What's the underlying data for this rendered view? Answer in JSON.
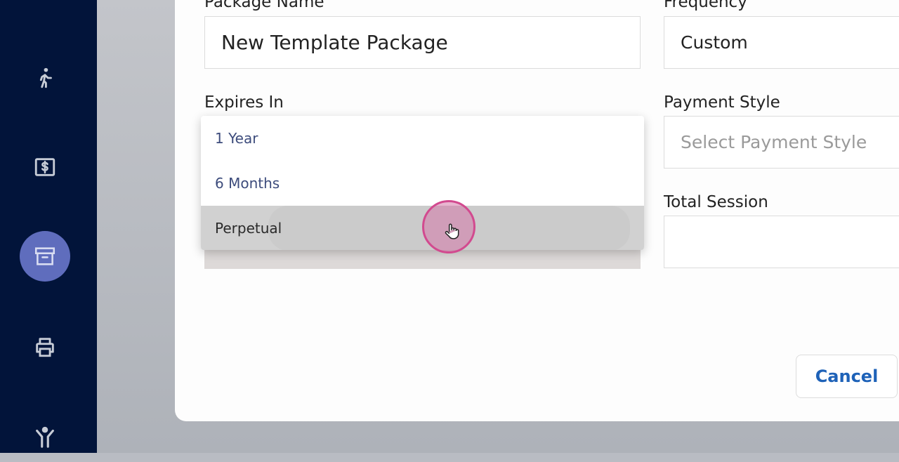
{
  "sidebar": {
    "items": [
      {
        "icon": "walking-person-icon"
      },
      {
        "icon": "dollar-box-icon"
      },
      {
        "icon": "archive-box-icon",
        "active": true
      },
      {
        "icon": "printer-icon"
      },
      {
        "icon": "person-arms-up-icon"
      }
    ]
  },
  "form": {
    "package_name": {
      "label": "Package Name",
      "value": "New Template Package"
    },
    "frequency": {
      "label": "Frequency",
      "value": "Custom"
    },
    "expires_in": {
      "label": "Expires In",
      "options": [
        "1 Year",
        "6 Months",
        "Perpetual"
      ],
      "hovered_option": "Perpetual"
    },
    "payment_style": {
      "label": "Payment Style",
      "placeholder": "Select Payment Style"
    },
    "total_session": {
      "label": "Total Session",
      "value": ""
    }
  },
  "actions": {
    "cancel_label": "Cancel"
  },
  "colors": {
    "sidebar_bg": "#02143a",
    "active_icon_bg": "#5f6dbd",
    "option_text": "#3d4c7c",
    "cancel_text": "#1e62b8",
    "cursor_ring": "#d24a8f"
  }
}
